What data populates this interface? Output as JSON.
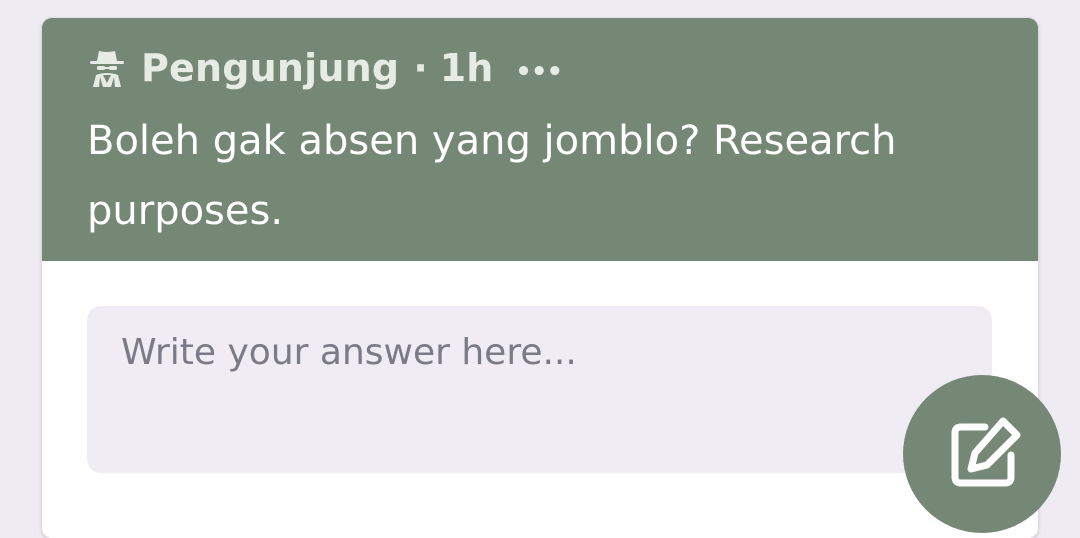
{
  "post": {
    "author": "Pengunjung",
    "separator": "·",
    "time": "1h",
    "more_label": "•••",
    "question": "Boleh gak absen yang jomblo? Research purposes.",
    "author_icon": "spy-icon"
  },
  "answer": {
    "placeholder": "Write your answer here..."
  },
  "fab": {
    "icon": "edit-icon"
  },
  "colors": {
    "header_bg": "#758875",
    "page_bg": "#efebf2",
    "input_bg": "#efecf3",
    "meta_text": "#e6ebe4",
    "placeholder_text": "#7a7b86"
  }
}
